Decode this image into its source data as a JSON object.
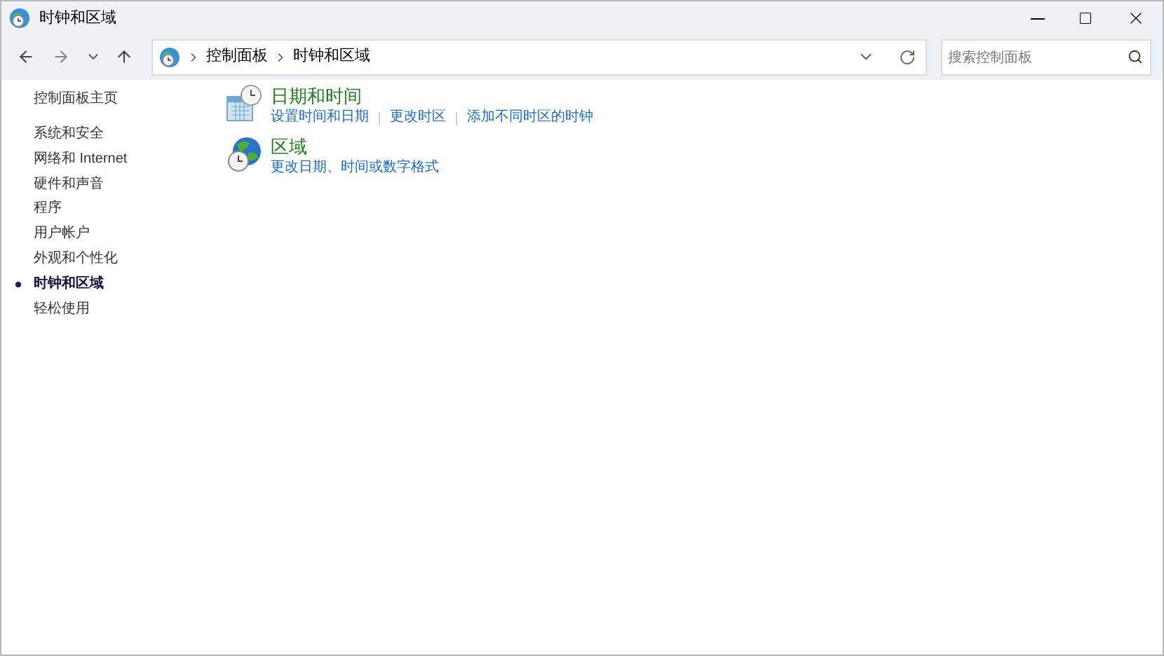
{
  "window": {
    "title": "时钟和区域"
  },
  "address": {
    "crumbs": [
      "控制面板",
      "时钟和区域"
    ]
  },
  "search": {
    "placeholder": "搜索控制面板"
  },
  "sidebar": {
    "home": "控制面板主页",
    "items": [
      {
        "label": "系统和安全",
        "selected": false
      },
      {
        "label": "网络和 Internet",
        "selected": false
      },
      {
        "label": "硬件和声音",
        "selected": false
      },
      {
        "label": "程序",
        "selected": false
      },
      {
        "label": "用户帐户",
        "selected": false
      },
      {
        "label": "外观和个性化",
        "selected": false
      },
      {
        "label": "时钟和区域",
        "selected": true
      },
      {
        "label": "轻松使用",
        "selected": false
      }
    ]
  },
  "categories": [
    {
      "kind": "datetime",
      "title": "日期和时间",
      "links": [
        "设置时间和日期",
        "更改时区",
        "添加不同时区的时钟"
      ]
    },
    {
      "kind": "region",
      "title": "区域",
      "links": [
        "更改日期、时间或数字格式"
      ]
    }
  ]
}
